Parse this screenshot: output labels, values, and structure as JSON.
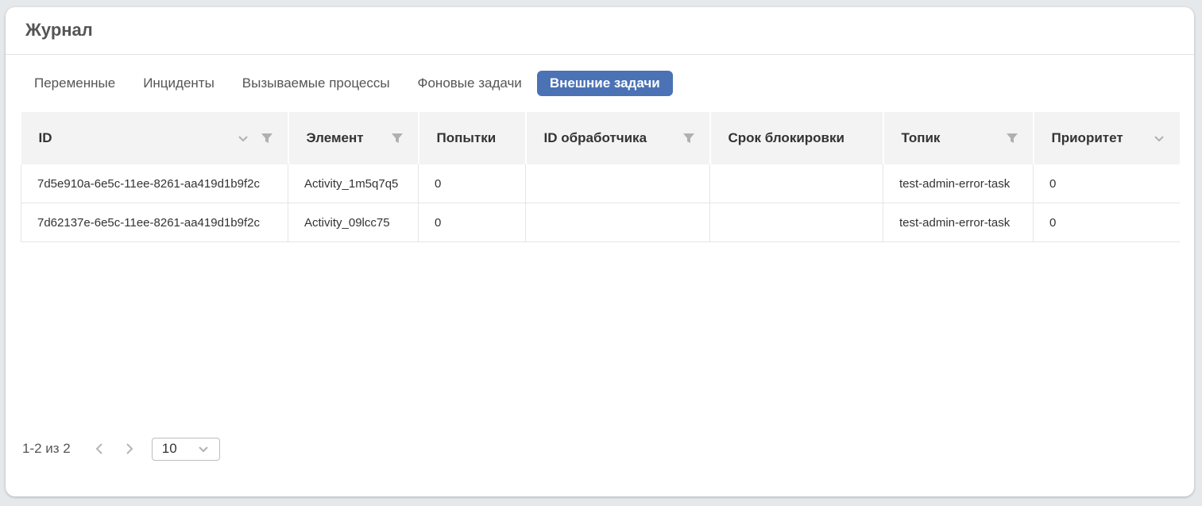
{
  "card": {
    "title": "Журнал"
  },
  "tabs": [
    {
      "label": "Переменные"
    },
    {
      "label": "Инциденты"
    },
    {
      "label": "Вызываемые процессы"
    },
    {
      "label": "Фоновые задачи"
    },
    {
      "label": "Внешние задачи",
      "active": true
    }
  ],
  "table": {
    "columns": [
      {
        "label": "ID",
        "icons": [
          "chevron-down-icon",
          "filter-icon"
        ]
      },
      {
        "label": "Элемент",
        "icons": [
          "filter-icon"
        ]
      },
      {
        "label": "Попытки",
        "icons": []
      },
      {
        "label": "ID обработчика",
        "icons": [
          "filter-icon"
        ]
      },
      {
        "label": "Срок блокировки",
        "icons": []
      },
      {
        "label": "Топик",
        "icons": [
          "filter-icon"
        ]
      },
      {
        "label": "Приоритет",
        "icons": [
          "chevron-down-icon"
        ]
      }
    ],
    "rows": [
      {
        "id": "7d5e910a-6e5c-11ee-8261-aa419d1b9f2c",
        "element": "Activity_1m5q7q5",
        "attempts": "0",
        "worker_id": "",
        "lock_expiration": "",
        "topic": "test-admin-error-task",
        "priority": "0"
      },
      {
        "id": "7d62137e-6e5c-11ee-8261-aa419d1b9f2c",
        "element": "Activity_09lcc75",
        "attempts": "0",
        "worker_id": "",
        "lock_expiration": "",
        "topic": "test-admin-error-task",
        "priority": "0"
      }
    ]
  },
  "pager": {
    "range_text": "1-2 из 2",
    "page_size": "10",
    "prev_icon": "chevron-left-icon",
    "next_icon": "chevron-right-icon"
  },
  "colors": {
    "accent": "#4a72b5",
    "header_bg": "#f3f3f3",
    "background": "#e6e9ec"
  }
}
